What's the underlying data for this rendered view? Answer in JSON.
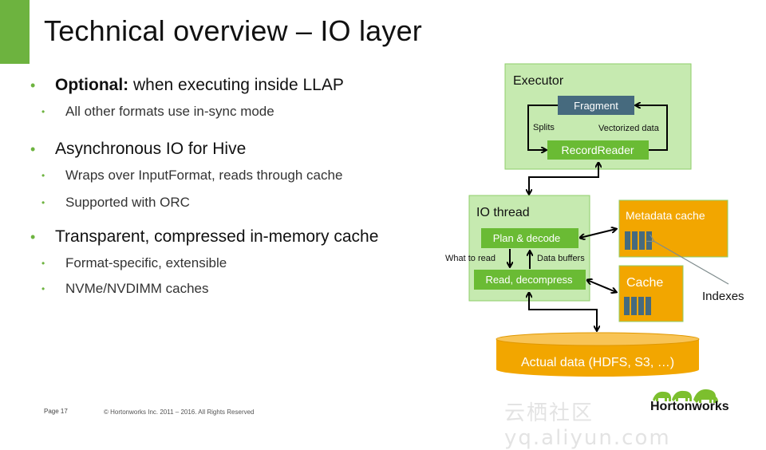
{
  "slide": {
    "title": "Technical overview – IO layer",
    "accent_color": "#6db33f"
  },
  "bullets": [
    {
      "level": 1,
      "bold": "Optional:",
      "text": " when executing inside LLAP"
    },
    {
      "level": 2,
      "text": "All other formats use in-sync mode"
    },
    {
      "level": 1,
      "text": "Asynchronous IO for Hive"
    },
    {
      "level": 2,
      "text": "Wraps over InputFormat, reads through cache"
    },
    {
      "level": 2,
      "text": "Supported with ORC"
    },
    {
      "level": 1,
      "text": "Transparent, compressed in-memory cache"
    },
    {
      "level": 2,
      "text": "Format-specific, extensible"
    },
    {
      "level": 2,
      "text": "NVMe/NVDIMM caches"
    }
  ],
  "bullet_glyph": "•",
  "diagram": {
    "executor": {
      "label": "Executor",
      "fragment": "Fragment",
      "record_reader": "RecordReader",
      "splits": "Splits",
      "vectorized": "Vectorized data"
    },
    "io_thread": {
      "label": "IO thread",
      "plan": "Plan & decode",
      "read": "Read, decompress",
      "what_to_read": "What to read",
      "data_buffers": "Data buffers"
    },
    "metadata_cache": {
      "label": "Metadata cache"
    },
    "cache": {
      "label": "Cache"
    },
    "indexes": "Indexes",
    "actual_data": "Actual data (HDFS, S3, …)",
    "colors": {
      "light_green": "#c6eab0",
      "green": "#6abb34",
      "slate": "#466a7e",
      "orange": "#f2a600"
    }
  },
  "footer": {
    "page": "Page 17",
    "copyright": "© Hortonworks Inc. 2011 – 2016. All Rights Reserved"
  },
  "logo": {
    "name": "Hortonworks"
  },
  "watermark": "云栖社区 yq.aliyun.com"
}
